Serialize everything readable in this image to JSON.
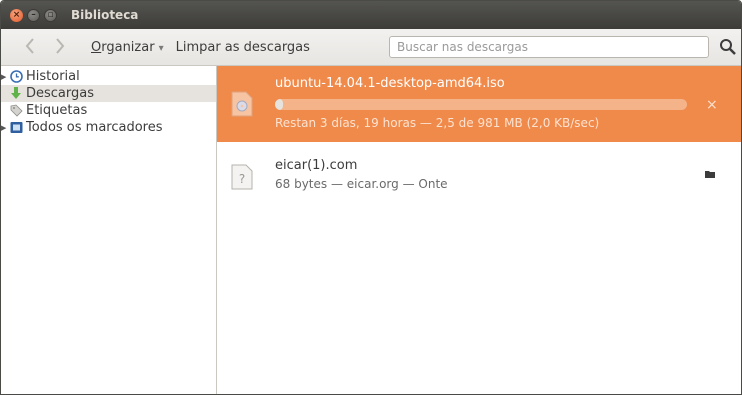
{
  "window": {
    "title": "Biblioteca"
  },
  "toolbar": {
    "back_icon": "back-arrow-icon",
    "forward_icon": "forward-arrow-icon",
    "organize_first": "O",
    "organize_rest": "rganizar",
    "clear_label": "Limpar as descargas",
    "search_placeholder": "Buscar nas descargas"
  },
  "sidebar": {
    "items": [
      {
        "label": "Historial",
        "icon": "clock-icon"
      },
      {
        "label": "Descargas",
        "icon": "download-arrow-icon"
      },
      {
        "label": "Etiquetas",
        "icon": "tag-icon"
      },
      {
        "label": "Todos os marcadores",
        "icon": "bookmarks-folder-icon"
      }
    ],
    "selected": "Descargas"
  },
  "downloads": [
    {
      "name": "ubuntu-14.04.1-desktop-amd64.iso",
      "status": "Restan 3 días, 19 horas — 2,5 de 981 MB (2,0 KB/sec)",
      "progress": 0.0025,
      "icon": "disc-file-icon",
      "action_icon": "cancel-icon",
      "action_glyph": "×"
    },
    {
      "name": "eicar(1).com",
      "status": "68 bytes — eicar.org — Onte",
      "icon": "unknown-file-icon",
      "action_icon": "open-folder-icon"
    }
  ],
  "colors": {
    "active_download_bg": "#f08a4b",
    "titlebar": "#3d3c38"
  }
}
